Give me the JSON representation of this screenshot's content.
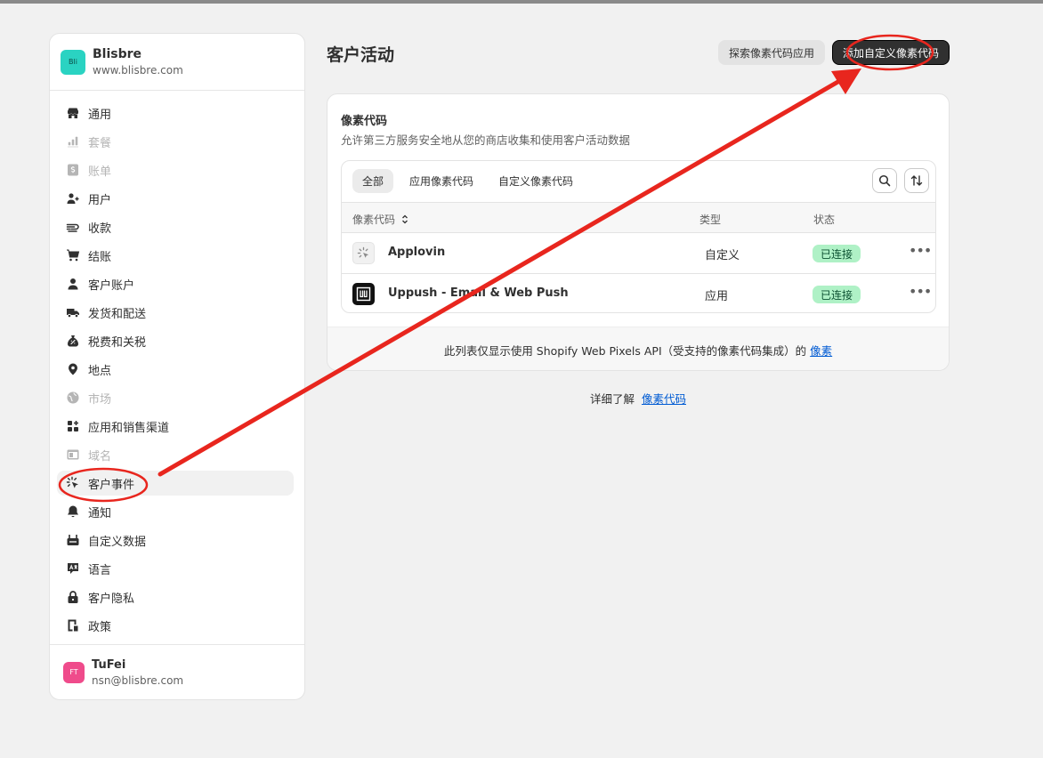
{
  "store": {
    "logo_text": "Bli",
    "name": "Blisbre",
    "url": "www.blisbre.com"
  },
  "sidebar": {
    "items": [
      {
        "label": "通用",
        "icon": "store-icon",
        "disabled": false
      },
      {
        "label": "套餐",
        "icon": "chart-icon",
        "disabled": true
      },
      {
        "label": "账单",
        "icon": "dollar-icon",
        "disabled": true
      },
      {
        "label": "用户",
        "icon": "users-icon",
        "disabled": false
      },
      {
        "label": "收款",
        "icon": "payment-icon",
        "disabled": false
      },
      {
        "label": "结账",
        "icon": "cart-icon",
        "disabled": false
      },
      {
        "label": "客户账户",
        "icon": "person-icon",
        "disabled": false
      },
      {
        "label": "发货和配送",
        "icon": "truck-icon",
        "disabled": false
      },
      {
        "label": "税费和关税",
        "icon": "money-bag-icon",
        "disabled": false
      },
      {
        "label": "地点",
        "icon": "location-icon",
        "disabled": false
      },
      {
        "label": "市场",
        "icon": "globe-icon",
        "disabled": true
      },
      {
        "label": "应用和销售渠道",
        "icon": "apps-icon",
        "disabled": false
      },
      {
        "label": "域名",
        "icon": "domain-icon",
        "disabled": true
      },
      {
        "label": "客户事件",
        "icon": "cursor-click-icon",
        "disabled": false,
        "active": true
      },
      {
        "label": "通知",
        "icon": "bell-icon",
        "disabled": false
      },
      {
        "label": "自定义数据",
        "icon": "database-icon",
        "disabled": false
      },
      {
        "label": "语言",
        "icon": "translate-icon",
        "disabled": false
      },
      {
        "label": "客户隐私",
        "icon": "lock-icon",
        "disabled": false
      },
      {
        "label": "政策",
        "icon": "policy-icon",
        "disabled": false
      }
    ]
  },
  "user": {
    "initials": "FT",
    "name": "TuFei",
    "email": "nsn@blisbre.com"
  },
  "header": {
    "title": "客户活动",
    "explore_button": "探索像素代码应用",
    "add_button": "添加自定义像素代码"
  },
  "card": {
    "title": "像素代码",
    "description": "允许第三方服务安全地从您的商店收集和使用客户活动数据",
    "tabs": [
      "全部",
      "应用像素代码",
      "自定义像素代码"
    ],
    "columns": {
      "name": "像素代码",
      "type": "类型",
      "status": "状态"
    },
    "rows": [
      {
        "name": "Applovin",
        "type": "自定义",
        "status": "已连接",
        "icon": "pixel-cursor-icon"
      },
      {
        "name": "Uppush - Email & Web Push",
        "type": "应用",
        "status": "已连接",
        "icon": "uppush-logo-icon"
      }
    ],
    "footer_text": "此列表仅显示使用 Shopify Web Pixels API（受支持的像素代码集成）的",
    "footer_link": "像素"
  },
  "learn_more": {
    "text": "详细了解",
    "link": "像素代码"
  },
  "colors": {
    "annotation": "#e8261e",
    "primary_button": "#303030",
    "success_badge": "#aff1c6",
    "link": "#005bd3"
  }
}
